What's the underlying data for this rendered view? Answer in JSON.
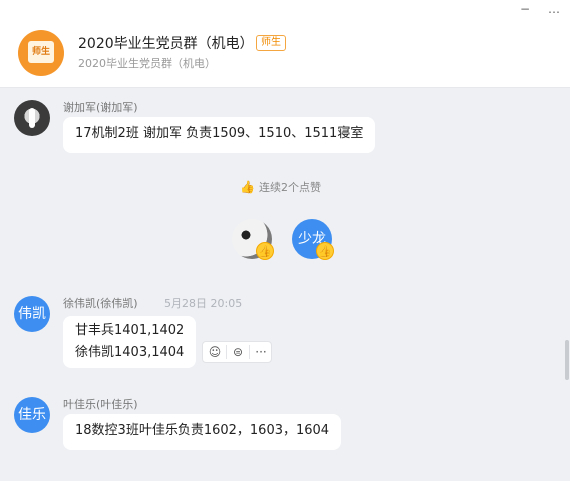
{
  "window": {
    "minimize_glyph": "−",
    "more_glyph": "…"
  },
  "group": {
    "avatar_text": "师生",
    "title": "2020毕业生党员群（机电）",
    "badge": "师生",
    "subtitle": "2020毕业生党员群（机电）"
  },
  "messages": [
    {
      "sender": "谢加军(谢加军)",
      "time": "",
      "avatar_text": "",
      "lines": [
        "17机制2班 谢加军 负责1509、1510、1511寝室"
      ]
    },
    {
      "sender": "徐伟凯(徐伟凯)",
      "time": "5月28日 20:05",
      "avatar_text": "伟凯",
      "lines": [
        "甘丰兵1401,1402",
        "徐伟凯1403,1404"
      ]
    },
    {
      "sender": "叶佳乐(叶佳乐)",
      "time": "",
      "avatar_text": "佳乐",
      "lines": [
        "18数控3班叶佳乐负责1602，1603，1604"
      ]
    }
  ],
  "likes": {
    "label": "连续2个点赞",
    "thumb_icon": "👍",
    "avatars": [
      {
        "kind": "panda",
        "text": ""
      },
      {
        "kind": "text",
        "text": "少龙"
      }
    ]
  },
  "message_actions": [
    {
      "name": "emoji-reaction-icon",
      "glyph": "☺"
    },
    {
      "name": "reply-icon",
      "glyph": "⊜"
    },
    {
      "name": "more-icon",
      "glyph": "···"
    }
  ],
  "colors": {
    "accent": "#3d8ef0",
    "group_avatar": "#f5962b",
    "badge": "#f08a00",
    "background": "#eef0f4"
  }
}
